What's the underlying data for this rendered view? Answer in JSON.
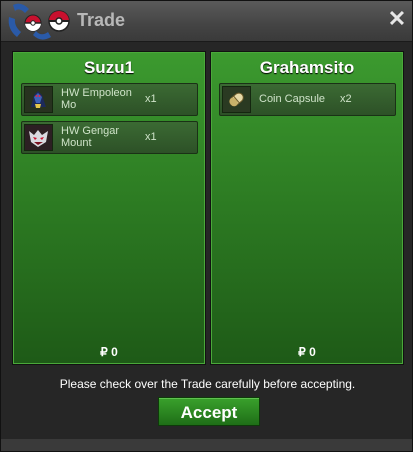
{
  "window": {
    "title": "Trade",
    "close_label": "✕"
  },
  "left_panel": {
    "player": "Suzu1",
    "items": [
      {
        "name": "HW Empoleon Mo",
        "qty": "x1",
        "icon": "empoleon-mount-icon"
      },
      {
        "name": "HW Gengar Mount",
        "qty": "x1",
        "icon": "gengar-mount-icon"
      }
    ],
    "money": "₽ 0"
  },
  "right_panel": {
    "player": "Grahamsito",
    "items": [
      {
        "name": "Coin Capsule",
        "qty": "x2",
        "icon": "coin-capsule-icon"
      }
    ],
    "money": "₽ 0"
  },
  "notice": "Please check over the Trade carefully before accepting.",
  "accept_label": "Accept"
}
